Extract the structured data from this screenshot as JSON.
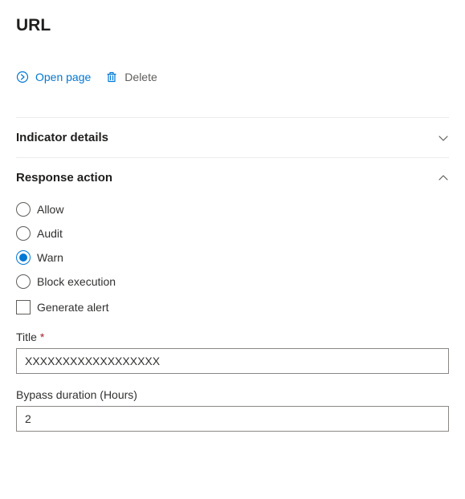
{
  "header": {
    "title": "URL"
  },
  "actions": {
    "open_page": "Open page",
    "delete": "Delete"
  },
  "sections": {
    "indicator_details": {
      "title": "Indicator details",
      "expanded": false
    },
    "response_action": {
      "title": "Response action",
      "expanded": true,
      "options": [
        {
          "label": "Allow",
          "selected": false
        },
        {
          "label": "Audit",
          "selected": false
        },
        {
          "label": "Warn",
          "selected": true
        },
        {
          "label": "Block execution",
          "selected": false
        }
      ],
      "generate_alert": {
        "label": "Generate alert",
        "checked": false
      },
      "title_field": {
        "label": "Title",
        "required": true,
        "value": "XXXXXXXXXXXXXXXXXX"
      },
      "bypass_duration": {
        "label": "Bypass duration (Hours)",
        "value": "2"
      }
    }
  }
}
